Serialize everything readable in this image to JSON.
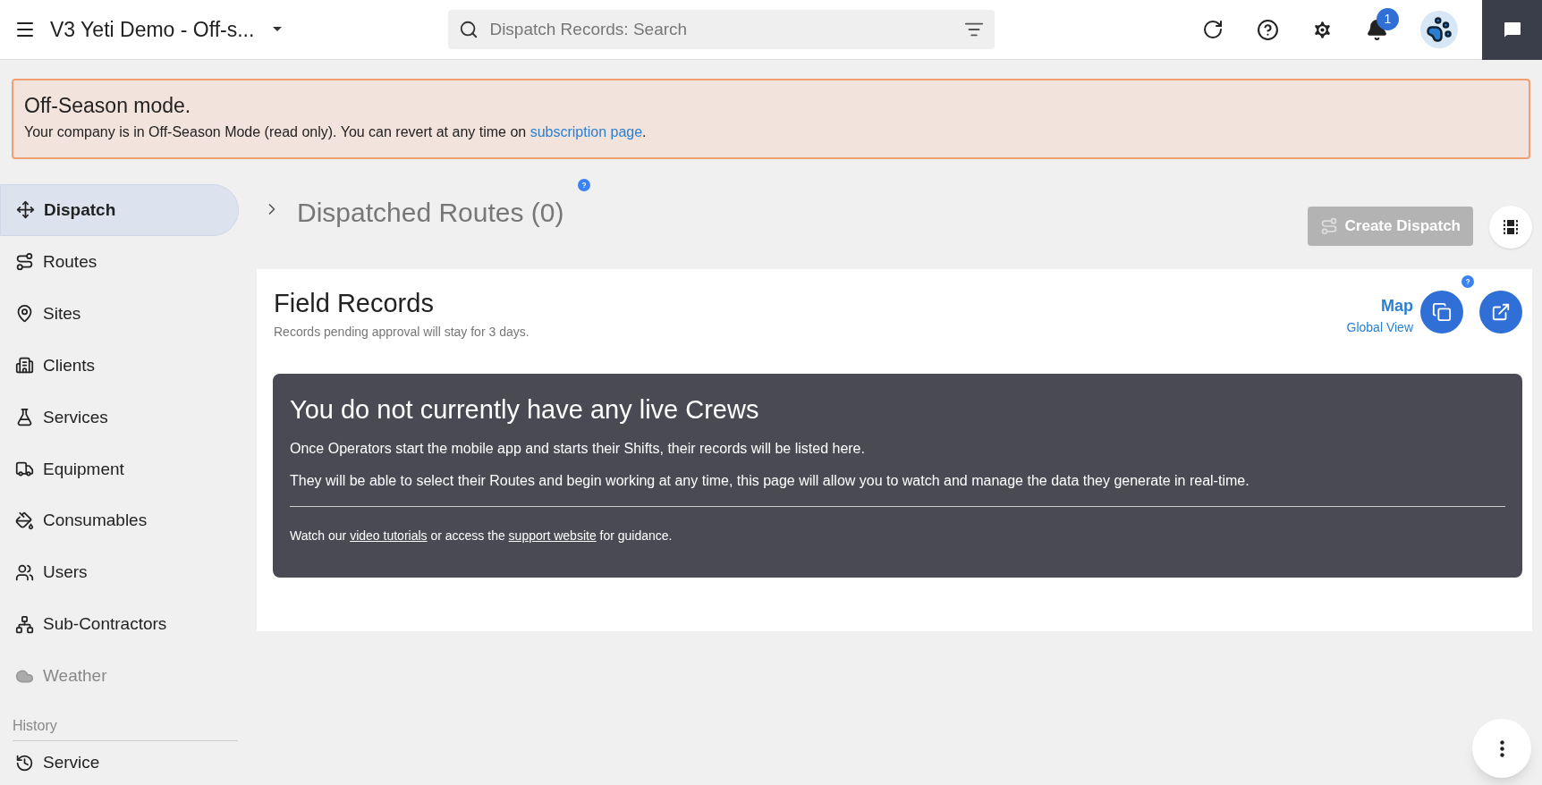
{
  "header": {
    "title": "V3 Yeti Demo - Off-s...",
    "search": {
      "placeholder": "Dispatch Records: Search"
    },
    "notification_count": "1"
  },
  "banner": {
    "title": "Off-Season mode.",
    "message": [
      {
        "kind": "text",
        "text": "Your company is in Off-Season Mode (read only). You can revert at any time on "
      },
      {
        "kind": "link",
        "text": "subscription page"
      },
      {
        "kind": "text",
        "text": "."
      }
    ]
  },
  "sidebar": {
    "items": [
      {
        "label": "Dispatch",
        "selected": true,
        "disabled": false
      },
      {
        "label": "Routes",
        "selected": false,
        "disabled": false
      },
      {
        "label": "Sites",
        "selected": false,
        "disabled": false
      },
      {
        "label": "Clients",
        "selected": false,
        "disabled": false
      },
      {
        "label": "Services",
        "selected": false,
        "disabled": false
      },
      {
        "label": "Equipment",
        "selected": false,
        "disabled": false
      },
      {
        "label": "Consumables",
        "selected": false,
        "disabled": false
      },
      {
        "label": "Users",
        "selected": false,
        "disabled": false
      },
      {
        "label": "Sub-Contractors",
        "selected": false,
        "disabled": false
      },
      {
        "label": "Weather",
        "selected": false,
        "disabled": true
      }
    ],
    "history_heading": "History",
    "history_items": [
      {
        "label": "Service",
        "selected": false
      }
    ]
  },
  "dispatched_routes": {
    "title": "Dispatched Routes (0)",
    "expanded": false,
    "create_button": {
      "label": "Create Dispatch",
      "disabled": true
    }
  },
  "field_records": {
    "title": "Field Records",
    "subtitle": "Records pending approval will stay for 3 days.",
    "map_link": "Map",
    "global_view_link": "Global View",
    "empty": {
      "title": "You do not currently have any live Crews",
      "paragraphs": [
        "Once Operators start the mobile app and starts their Shifts, their records will be listed here.",
        "They will be able to select their Routes and begin working at any time, this page will allow you to watch and manage the data they generate in real-time."
      ],
      "footer": [
        {
          "kind": "text",
          "text": "Watch our "
        },
        {
          "kind": "link",
          "text": "video tutorials"
        },
        {
          "kind": "text",
          "text": " or access the "
        },
        {
          "kind": "link",
          "text": "support website"
        },
        {
          "kind": "text",
          "text": " for guidance."
        }
      ]
    }
  }
}
